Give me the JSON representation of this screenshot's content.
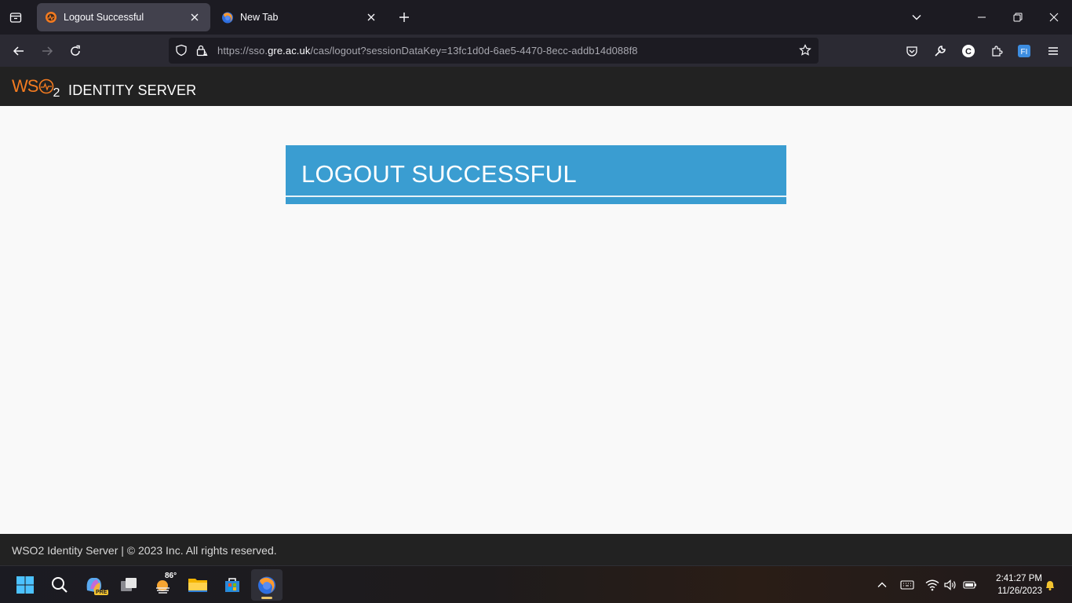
{
  "browser": {
    "tabs": [
      {
        "title": "Logout Successful",
        "active": true
      },
      {
        "title": "New Tab",
        "active": false
      }
    ],
    "url": {
      "prefix": "https://sso.",
      "host": "gre.ac.uk",
      "path": "/cas/logout?sessionDataKey=13fc1d0d-6ae5-4470-8ecc-addb14d088f8"
    },
    "toolbar_icons": [
      "pocket-icon",
      "wrench-icon",
      "c-extension-icon",
      "extensions-icon",
      "fi-extension-icon",
      "menu-icon"
    ],
    "fi_label": "FI",
    "c_label": "C"
  },
  "site": {
    "logo": {
      "wso": "WS",
      "sub": "2"
    },
    "product_name": "IDENTITY SERVER",
    "logout_title": "LOGOUT SUCCESSFUL",
    "footer": "WSO2 Identity Server | © 2023 Inc. All rights reserved.",
    "colors": {
      "header_bg": "#222222",
      "panel_bg": "#3a9dd1",
      "brand_orange": "#f47b20",
      "page_bg": "#f9f9f9"
    }
  },
  "taskbar": {
    "weather_temp": "86°",
    "copilot_badge": "PRE",
    "clock_time": "2:41:27 PM",
    "clock_date": "11/26/2023"
  }
}
